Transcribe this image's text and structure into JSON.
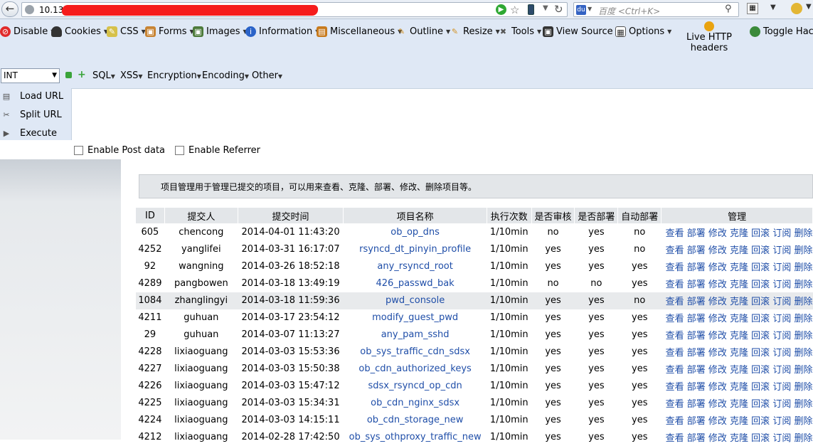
{
  "browser": {
    "url_prefix": "10.13.",
    "search_placeholder": "百度 <Ctrl+K>",
    "search_engine_logo": "du"
  },
  "hackbar": {
    "menu": [
      "Disable",
      "Cookies",
      "CSS",
      "Forms",
      "Images",
      "Information",
      "Miscellaneous",
      "Outline",
      "Resize",
      "Tools",
      "View Source",
      "Options"
    ],
    "live_http": "Live HTTP headers",
    "toggle": "Toggle Hack",
    "int_select": "INT",
    "row2": [
      "SQL",
      "XSS",
      "Encryption",
      "Encoding",
      "Other"
    ],
    "actions": [
      "Load URL",
      "Split URL",
      "Execute"
    ],
    "checks": [
      "Enable Post data",
      "Enable Referrer"
    ]
  },
  "notice": "项目管理用于管理已提交的项目，可以用来查看、克隆、部署、修改、删除项目等。",
  "table": {
    "headers": [
      "ID",
      "提交人",
      "提交时间",
      "项目名称",
      "执行次数",
      "是否审核",
      "是否部署",
      "自动部署",
      "管理"
    ],
    "ops": "查看 部署 修改 克隆 回滚 订阅 删除",
    "rows": [
      [
        "605",
        "chencong",
        "2014-04-01 11:43:20",
        "ob_op_dns",
        "1/10min",
        "no",
        "yes",
        "no"
      ],
      [
        "4252",
        "yanglifei",
        "2014-03-31 16:17:07",
        "rsyncd_dt_pinyin_profile",
        "1/10min",
        "yes",
        "yes",
        "no"
      ],
      [
        "92",
        "wangning",
        "2014-03-26 18:52:18",
        "any_rsyncd_root",
        "1/10min",
        "yes",
        "yes",
        "yes"
      ],
      [
        "4289",
        "pangbowen",
        "2014-03-18 13:49:19",
        "426_passwd_bak",
        "1/10min",
        "no",
        "no",
        "yes"
      ],
      [
        "1084",
        "zhanglingyi",
        "2014-03-18 11:59:36",
        "pwd_console",
        "1/10min",
        "yes",
        "yes",
        "no"
      ],
      [
        "4211",
        "guhuan",
        "2014-03-17 23:54:12",
        "modify_guest_pwd",
        "1/10min",
        "yes",
        "yes",
        "yes"
      ],
      [
        "29",
        "guhuan",
        "2014-03-07 11:13:27",
        "any_pam_sshd",
        "1/10min",
        "yes",
        "yes",
        "yes"
      ],
      [
        "4228",
        "lixiaoguang",
        "2014-03-03 15:53:36",
        "ob_sys_traffic_cdn_sdsx",
        "1/10min",
        "yes",
        "yes",
        "yes"
      ],
      [
        "4227",
        "lixiaoguang",
        "2014-03-03 15:50:38",
        "ob_cdn_authorized_keys",
        "1/10min",
        "yes",
        "yes",
        "yes"
      ],
      [
        "4226",
        "lixiaoguang",
        "2014-03-03 15:47:12",
        "sdsx_rsyncd_op_cdn",
        "1/10min",
        "yes",
        "yes",
        "yes"
      ],
      [
        "4225",
        "lixiaoguang",
        "2014-03-03 15:34:31",
        "ob_cdn_nginx_sdsx",
        "1/10min",
        "yes",
        "yes",
        "yes"
      ],
      [
        "4224",
        "lixiaoguang",
        "2014-03-03 14:15:11",
        "ob_cdn_storage_new",
        "1/10min",
        "yes",
        "yes",
        "yes"
      ],
      [
        "4212",
        "lixiaoguang",
        "2014-02-28 17:42:50",
        "ob_sys_othproxy_traffic_new",
        "1/10min",
        "yes",
        "yes",
        "yes"
      ]
    ]
  }
}
